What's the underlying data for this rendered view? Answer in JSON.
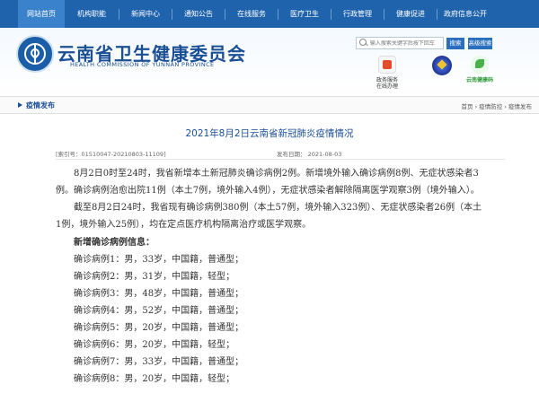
{
  "nav": {
    "items": [
      "网站首页",
      "机构职能",
      "新闻中心",
      "通知公告",
      "在线服务",
      "医疗卫生",
      "行政管理",
      "健康促进",
      "政府信息公开"
    ]
  },
  "header": {
    "title_cn": "云南省卫生健康委员会",
    "title_en": "HEALTH COMMISSION OF YUNNAN PROVINCE",
    "search_placeholder": "输入搜索关键字后按下回车",
    "search_button": "搜索",
    "advanced_search_button": "高级搜索",
    "service_label": "政务服务\n在线办理",
    "health_code_label": "云南健康码"
  },
  "breadcrumb": {
    "section": "疫情发布",
    "path": [
      "首页",
      "疫情防控",
      "疫情发布"
    ],
    "separator": " › "
  },
  "article": {
    "title": "2021年8月2日云南省新冠肺炎疫情情况",
    "index": "[索引号：01510047-20210803-11109]",
    "publish_date": "发布日期： 2021-08-03",
    "paragraphs": [
      "8月2日0时至24时，我省新增本土新冠肺炎确诊病例2例。新增境外输入确诊病例8例、无症状感染者3例。确诊病例治愈出院11例（本土7例，境外输入4例），无症状感染者解除隔离医学观察3例（境外输入）。",
      "截至8月2日24时，我省现有确诊病例380例（本土57例，境外输入323例）、无症状感染者26例（本土1例，境外输入25例），均在定点医疗机构隔离治疗或医学观察。"
    ],
    "subheading": "新增确诊病例信息：",
    "cases": [
      "确诊病例1：男，33岁，中国籍，普通型；",
      "确诊病例2：男，31岁，中国籍，轻型；",
      "确诊病例3：男，48岁，中国籍，普通型；",
      "确诊病例4：男，52岁，中国籍，普通型；",
      "确诊病例5：男，20岁，中国籍，普通型；",
      "确诊病例6：男，20岁，中国籍，轻型；",
      "确诊病例7：男，33岁，中国籍，普通型；",
      "确诊病例8：男，20岁，中国籍，轻型；"
    ]
  }
}
